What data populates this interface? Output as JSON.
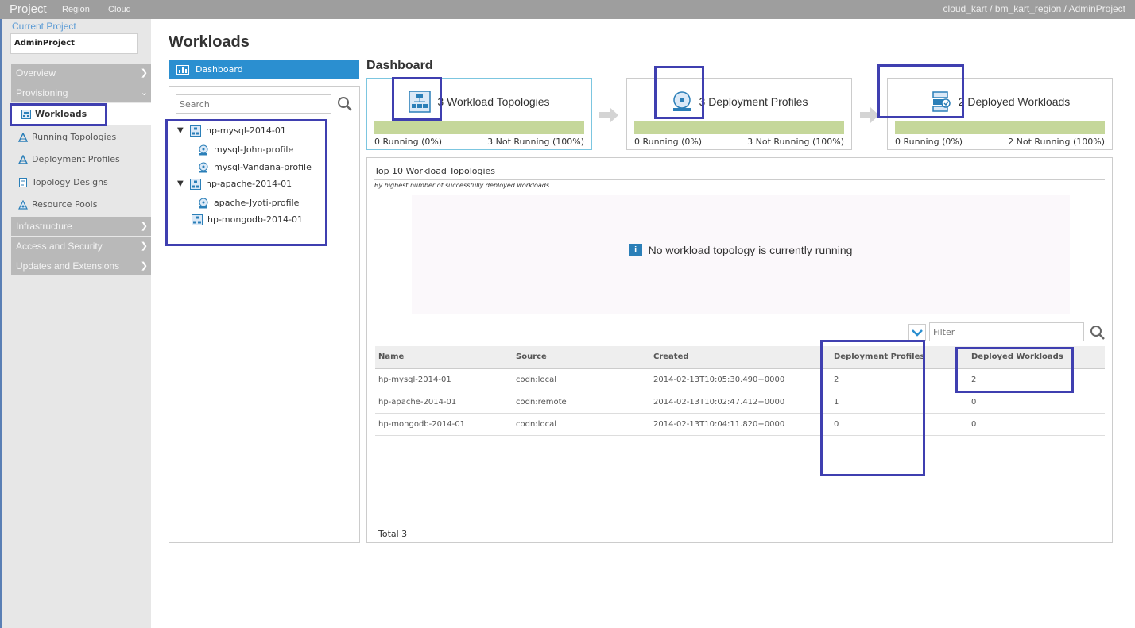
{
  "topbar": {
    "project": "Project",
    "region": "Region",
    "cloud": "Cloud",
    "breadcrumb": "cloud_kart / bm_kart_region / AdminProject"
  },
  "sidebar": {
    "current_project_label": "Current Project",
    "current_project": "AdminProject",
    "sections": {
      "overview": "Overview",
      "provisioning": "Provisioning",
      "infrastructure": "Infrastructure",
      "access": "Access and Security",
      "updates": "Updates and Extensions"
    },
    "items": {
      "workloads": "Workloads",
      "running_topologies": "Running Topologies",
      "deployment_profiles": "Deployment Profiles",
      "topology_designs": "Topology Designs",
      "resource_pools": "Resource Pools"
    }
  },
  "main": {
    "title": "Workloads",
    "dashboard_tab": "Dashboard",
    "dashboard_heading": "Dashboard"
  },
  "tree": {
    "search_placeholder": "Search",
    "nodes": [
      {
        "label": "hp-mysql-2014-01"
      },
      {
        "label": "mysql-John-profile"
      },
      {
        "label": "mysql-Vandana-profile"
      },
      {
        "label": "hp-apache-2014-01"
      },
      {
        "label": "apache-Jyoti-profile"
      },
      {
        "label": "hp-mongodb-2014-01"
      }
    ]
  },
  "cards": [
    {
      "title": "3 Workload Topologies",
      "running": "0 Running (0%)",
      "not_running": "3 Not Running (100%)"
    },
    {
      "title": "3 Deployment Profiles",
      "running": "0 Running (0%)",
      "not_running": "3 Not Running (100%)"
    },
    {
      "title": "2 Deployed Workloads",
      "running": "0 Running (0%)",
      "not_running": "2 Not Running (100%)"
    }
  ],
  "top_panel": {
    "title": "Top 10 Workload Topologies",
    "subtitle": "By highest number of successfully deployed workloads",
    "empty_message": "No workload topology is currently running",
    "filter_placeholder": "Filter",
    "total": "Total 3"
  },
  "table": {
    "headers": [
      "Name",
      "Source",
      "Created",
      "Deployment Profiles",
      "Deployed Workloads"
    ],
    "rows": [
      [
        "hp-mysql-2014-01",
        "codn:local",
        "2014-02-13T10:05:30.490+0000",
        "2",
        "2"
      ],
      [
        "hp-apache-2014-01",
        "codn:remote",
        "2014-02-13T10:02:47.412+0000",
        "1",
        "0"
      ],
      [
        "hp-mongodb-2014-01",
        "codn:local",
        "2014-02-13T10:04:11.820+0000",
        "0",
        "0"
      ]
    ]
  },
  "colors": {
    "accent": "#2b8fd0",
    "highlight": "#3f3fb0",
    "bar_fill": "#c5d79a",
    "sidebar_section": "#b9b9b9"
  }
}
